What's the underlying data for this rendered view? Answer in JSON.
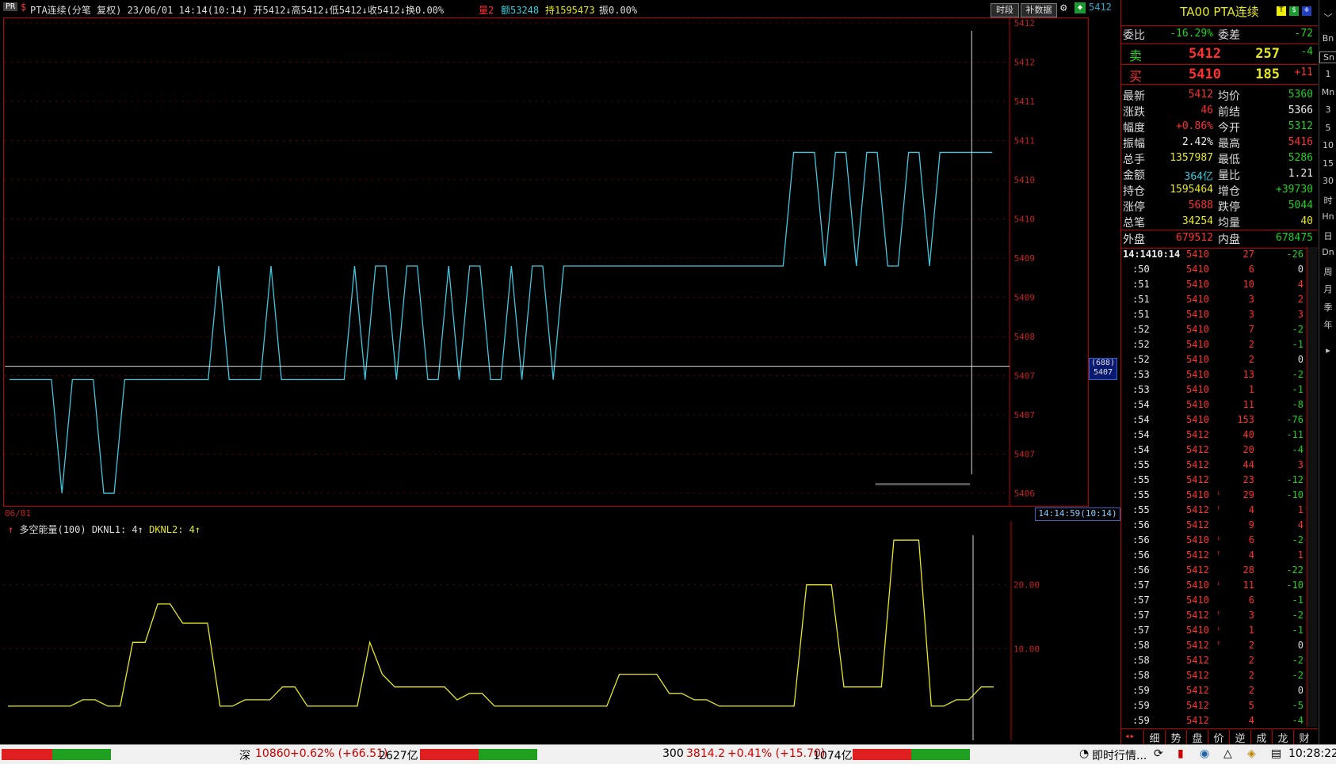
{
  "title": {
    "tag": "PR",
    "info": "PTA连续(分笔 复权) 23/06/01 14:14(10:14) 开5412↓高5412↓低5412↓收5412↓换0.00%",
    "vol": "量2",
    "amount": "额53248",
    "hold": "持1595473",
    "amp": "振0.00%",
    "btn_period": "时段",
    "btn_fill": "补数据"
  },
  "main_chart": {
    "yticks": [
      "5412",
      "5412",
      "5411",
      "5411",
      "5410",
      "5410",
      "5409",
      "5409",
      "5408",
      "5407",
      "5407",
      "5407",
      "5406"
    ],
    "price_tag": "5412",
    "cursor_count": "(688)",
    "cursor_price": "5407",
    "date_label": "06/01",
    "time_label": "14:14:59(10:14)",
    "series": [
      5407.5,
      5407.5,
      5407.5,
      5407.5,
      5407.5,
      5406,
      5407.5,
      5407.5,
      5407.5,
      5406,
      5406,
      5407.5,
      5407.5,
      5407.5,
      5407.5,
      5407.5,
      5407.5,
      5407.5,
      5407.5,
      5407.5,
      5409,
      5407.5,
      5407.5,
      5407.5,
      5407.5,
      5409,
      5407.5,
      5407.5,
      5407.5,
      5407.5,
      5407.5,
      5407.5,
      5407.5,
      5409,
      5407.5,
      5409,
      5409,
      5407.5,
      5409,
      5409,
      5407.5,
      5407.5,
      5409,
      5407.5,
      5409,
      5409,
      5407.5,
      5407.5,
      5409,
      5407.5,
      5409,
      5409,
      5407.5,
      5409,
      5409,
      5409,
      5409,
      5409,
      5409,
      5409,
      5409,
      5409,
      5409,
      5409,
      5409,
      5409,
      5409,
      5409,
      5409,
      5409,
      5409,
      5409,
      5409,
      5409,
      5409,
      5410.5,
      5410.5,
      5410.5,
      5409,
      5410.5,
      5410.5,
      5409,
      5410.5,
      5410.5,
      5409,
      5409,
      5410.5,
      5410.5,
      5409,
      5410.5,
      5410.5,
      5410.5,
      5410.5,
      5410.5,
      5410.5
    ]
  },
  "sub_chart": {
    "legend_name": "多空能量(100)",
    "legend_l1": "DKNL1: 4",
    "legend_l2": "DKNL2: 4",
    "yticks": [
      "20.00",
      "10.00"
    ],
    "series": [
      1,
      1,
      1,
      1,
      1,
      1,
      2,
      2,
      1,
      1,
      11,
      11,
      17,
      17,
      14,
      14,
      14,
      1,
      1,
      2,
      2,
      2,
      4,
      4,
      1,
      1,
      1,
      1,
      1,
      11,
      6,
      4,
      4,
      4,
      4,
      4,
      2,
      3,
      3,
      1,
      1,
      1,
      1,
      1,
      1,
      1,
      1,
      1,
      1,
      6,
      6,
      6,
      6,
      3,
      3,
      2,
      2,
      1,
      1,
      1,
      1,
      1,
      1,
      1,
      20,
      20,
      20,
      4,
      4,
      4,
      4,
      27,
      27,
      27,
      1,
      1,
      2,
      2,
      4,
      4
    ]
  },
  "right_panel": {
    "header": "TA00  PTA连续",
    "wb_label": "委比",
    "wb_val": "-16.29%",
    "wc_label": "委差",
    "wc_val": "-72",
    "sell_label": "卖",
    "sell_price": "5412",
    "sell_vol": "257",
    "sell_chg": "-4",
    "buy_label": "买",
    "buy_price": "5410",
    "buy_vol": "185",
    "buy_chg": "+11",
    "stats": [
      {
        "l1": "最新",
        "v1": "5412",
        "c1": "red",
        "l2": "均价",
        "v2": "5360",
        "c2": "grn"
      },
      {
        "l1": "涨跌",
        "v1": "46",
        "c1": "red",
        "l2": "前结",
        "v2": "5366",
        "c2": "wht"
      },
      {
        "l1": "幅度",
        "v1": "+0.86%",
        "c1": "red",
        "l2": "今开",
        "v2": "5312",
        "c2": "grn"
      },
      {
        "l1": "振幅",
        "v1": "2.42%",
        "c1": "wht",
        "l2": "最高",
        "v2": "5416",
        "c2": "red"
      },
      {
        "l1": "总手",
        "v1": "1357987",
        "c1": "yel",
        "l2": "最低",
        "v2": "5286",
        "c2": "grn"
      },
      {
        "l1": "金额",
        "v1": "364亿",
        "c1": "cyn",
        "l2": "量比",
        "v2": "1.21",
        "c2": "wht"
      },
      {
        "l1": "持仓",
        "v1": "1595464",
        "c1": "yel",
        "l2": "增仓",
        "v2": "+39730",
        "c2": "grn"
      },
      {
        "l1": "涨停",
        "v1": "5688",
        "c1": "red",
        "l2": "跌停",
        "v2": "5044",
        "c2": "grn"
      },
      {
        "l1": "总笔",
        "v1": "34254",
        "c1": "yel",
        "l2": "均量",
        "v2": "40",
        "c2": "yel"
      }
    ],
    "outer_label": "外盘",
    "outer_val": "679512",
    "inner_label": "内盘",
    "inner_val": "678475",
    "ticks": [
      {
        "t": "14:1410:14",
        "p": "5410",
        "a": "",
        "v": "27",
        "d": "-26"
      },
      {
        "t": ":50",
        "p": "5410",
        "a": "",
        "v": "6",
        "d": "0"
      },
      {
        "t": ":51",
        "p": "5410",
        "a": "",
        "v": "10",
        "d": "4"
      },
      {
        "t": ":51",
        "p": "5410",
        "a": "",
        "v": "3",
        "d": "2"
      },
      {
        "t": ":51",
        "p": "5410",
        "a": "",
        "v": "3",
        "d": "3"
      },
      {
        "t": ":52",
        "p": "5410",
        "a": "",
        "v": "7",
        "d": "-2"
      },
      {
        "t": ":52",
        "p": "5410",
        "a": "",
        "v": "2",
        "d": "-1"
      },
      {
        "t": ":52",
        "p": "5410",
        "a": "",
        "v": "2",
        "d": "0"
      },
      {
        "t": ":53",
        "p": "5410",
        "a": "",
        "v": "13",
        "d": "-2"
      },
      {
        "t": ":53",
        "p": "5410",
        "a": "",
        "v": "1",
        "d": "-1"
      },
      {
        "t": ":54",
        "p": "5410",
        "a": "",
        "v": "11",
        "d": "-8"
      },
      {
        "t": ":54",
        "p": "5410",
        "a": "",
        "v": "153",
        "d": "-76"
      },
      {
        "t": ":54",
        "p": "5412",
        "a": "",
        "v": "40",
        "d": "-11"
      },
      {
        "t": ":54",
        "p": "5412",
        "a": "",
        "v": "20",
        "d": "-4"
      },
      {
        "t": ":55",
        "p": "5412",
        "a": "",
        "v": "44",
        "d": "3"
      },
      {
        "t": ":55",
        "p": "5412",
        "a": "",
        "v": "23",
        "d": "-12"
      },
      {
        "t": ":55",
        "p": "5410",
        "a": "↓",
        "v": "29",
        "d": "-10"
      },
      {
        "t": ":55",
        "p": "5412",
        "a": "↑",
        "v": "4",
        "d": "1"
      },
      {
        "t": ":56",
        "p": "5412",
        "a": "",
        "v": "9",
        "d": "4"
      },
      {
        "t": ":56",
        "p": "5410",
        "a": "↓",
        "v": "6",
        "d": "-2"
      },
      {
        "t": ":56",
        "p": "5412",
        "a": "↑",
        "v": "4",
        "d": "1"
      },
      {
        "t": ":56",
        "p": "5412",
        "a": "",
        "v": "28",
        "d": "-22"
      },
      {
        "t": ":57",
        "p": "5410",
        "a": "↓",
        "v": "11",
        "d": "-10"
      },
      {
        "t": ":57",
        "p": "5410",
        "a": "",
        "v": "6",
        "d": "-1"
      },
      {
        "t": ":57",
        "p": "5412",
        "a": "↑",
        "v": "3",
        "d": "-2"
      },
      {
        "t": ":57",
        "p": "5410",
        "a": "↓",
        "v": "1",
        "d": "-1"
      },
      {
        "t": ":58",
        "p": "5412",
        "a": "↑",
        "v": "2",
        "d": "0"
      },
      {
        "t": ":58",
        "p": "5412",
        "a": "",
        "v": "2",
        "d": "-2"
      },
      {
        "t": ":58",
        "p": "5412",
        "a": "",
        "v": "2",
        "d": "-2"
      },
      {
        "t": ":59",
        "p": "5412",
        "a": "",
        "v": "2",
        "d": "0"
      },
      {
        "t": ":59",
        "p": "5412",
        "a": "",
        "v": "5",
        "d": "-5"
      },
      {
        "t": ":59",
        "p": "5412",
        "a": "",
        "v": "4",
        "d": "-4"
      }
    ],
    "tabs": [
      "细",
      "势",
      "盘",
      "价",
      "逆",
      "成",
      "龙",
      "财"
    ]
  },
  "side_tabs": [
    "Bn",
    "Sn",
    "1",
    "Mn",
    "3",
    "5",
    "10",
    "15",
    "30",
    "时",
    "Hn",
    "日",
    "Dn",
    "周",
    "月",
    "季",
    "年"
  ],
  "status": {
    "sz_label": "深",
    "sz_val": "10860",
    "sz_chg": "+0.62% (+66.51)",
    "sz_amt": "2627亿",
    "hs_label": "300",
    "hs_val": "3814.2",
    "hs_chg": "+0.41% (+15.70)",
    "hs_amt": "1074亿",
    "live": "即时行情...",
    "clock": "10:28:22"
  }
}
